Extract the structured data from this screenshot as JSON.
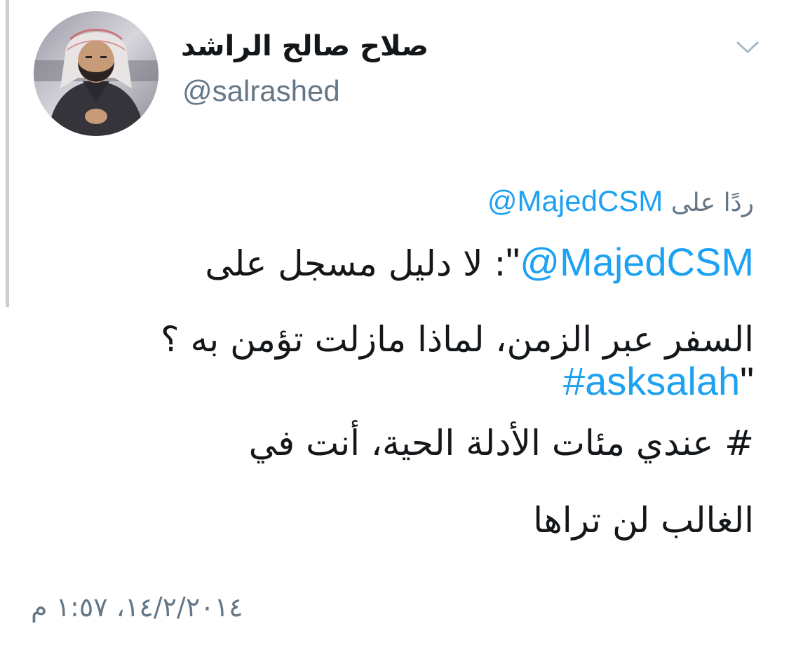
{
  "author": {
    "display_name": "صلاح صالح الراشد",
    "handle": "@salrashed",
    "avatar_icon": "user-avatar-photo"
  },
  "menu": {
    "icon": "chevron-down-icon"
  },
  "reply": {
    "prefix": "ردًا على",
    "mention": "@MajedCSM"
  },
  "tweet": {
    "line1": {
      "quote_open": "\"",
      "mention": "@MajedCSM",
      "text": ": لا دليل مسجل على"
    },
    "line2": "السفر عبر الزمن، لماذا مازلت تؤمن به ؟",
    "line3": {
      "hashtag": "#asksalah",
      "quote_close": "\""
    },
    "line4": "# عندي مئات الأدلة الحية، أنت في",
    "line5": "الغالب لن تراها"
  },
  "timestamp": "١٤/٢/٢٠١٤، ١:٥٧ م",
  "colors": {
    "link": "#1da1f2",
    "secondary_text": "#657786",
    "primary_text": "#14171a",
    "thread_line": "#c8cdd2"
  }
}
